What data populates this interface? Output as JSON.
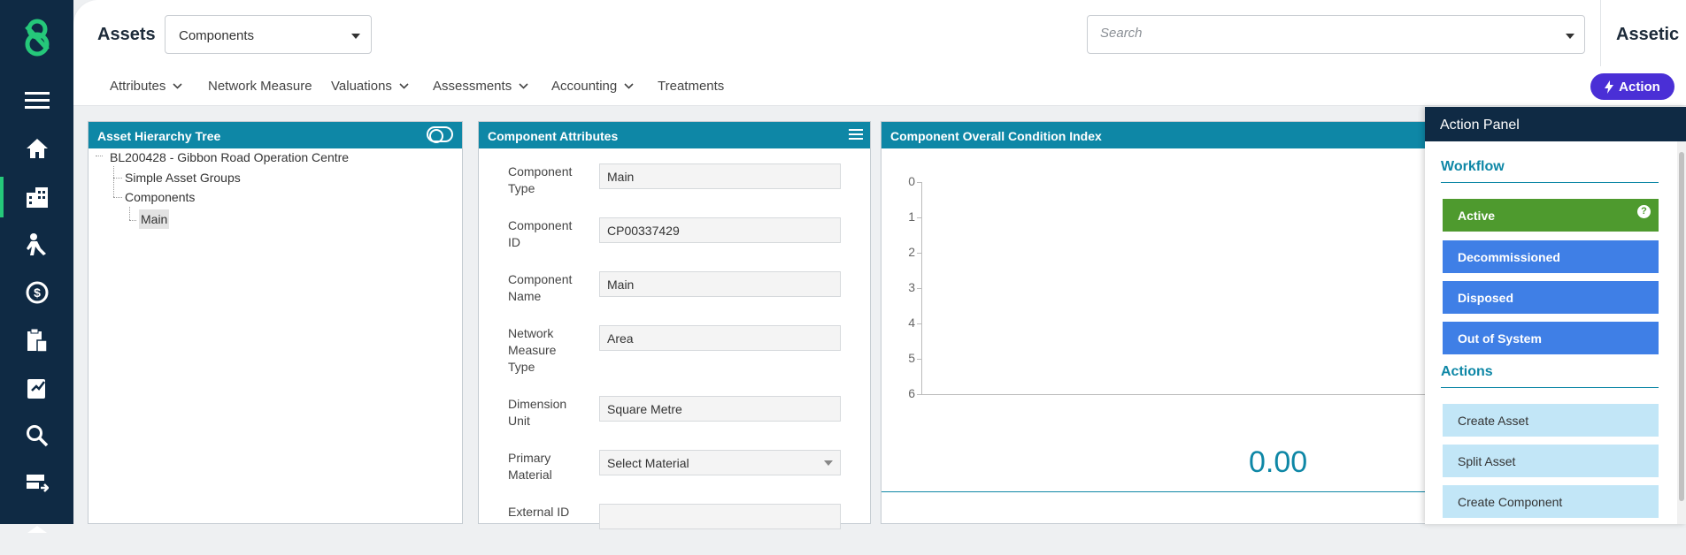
{
  "rail": {
    "icons": [
      "menu-icon",
      "home-icon",
      "buildings-icon",
      "worker-icon",
      "finance-icon",
      "clipboard-icon",
      "assessment-icon",
      "search-icon",
      "server-icon"
    ]
  },
  "header": {
    "title": "Assets",
    "module_select": "Components",
    "search_placeholder": "Search",
    "brand": "Assetic"
  },
  "subnav": {
    "items": [
      {
        "label": "Attributes",
        "dropdown": true
      },
      {
        "label": "Network Measure",
        "dropdown": false
      },
      {
        "label": "Valuations",
        "dropdown": true
      },
      {
        "label": "Assessments",
        "dropdown": true
      },
      {
        "label": "Accounting",
        "dropdown": true
      },
      {
        "label": "Treatments",
        "dropdown": false
      }
    ],
    "action_label": "Action"
  },
  "tree": {
    "title": "Asset Hierarchy Tree",
    "root": "BL200428 - Gibbon Road Operation Centre",
    "child1": "Simple Asset Groups",
    "child2": "Components",
    "leaf": "Main"
  },
  "attributes": {
    "title": "Component Attributes",
    "rows": [
      {
        "label": "Component Type",
        "value": "Main"
      },
      {
        "label": "Component ID",
        "value": "CP00337429"
      },
      {
        "label": "Component Name",
        "value": "Main"
      },
      {
        "label": "Network Measure Type",
        "value": "Area"
      },
      {
        "label": "Dimension Unit",
        "value": "Square Metre"
      },
      {
        "label": "Primary Material",
        "value": "Select Material"
      },
      {
        "label": "External ID",
        "value": ""
      }
    ]
  },
  "condition": {
    "title": "Component Overall Condition Index",
    "y_ticks": [
      "0",
      "1",
      "2",
      "3",
      "4",
      "5",
      "6"
    ],
    "value": "0.00"
  },
  "action_panel": {
    "title": "Action Panel",
    "workflow_label": "Workflow",
    "workflow": [
      {
        "label": "Active",
        "state": "active"
      },
      {
        "label": "Decommissioned",
        "state": "blue"
      },
      {
        "label": "Disposed",
        "state": "blue"
      },
      {
        "label": "Out of System",
        "state": "blue"
      }
    ],
    "actions_label": "Actions",
    "actions": [
      "Create Asset",
      "Split Asset",
      "Create Component"
    ],
    "help": "?"
  },
  "colors": {
    "rail": "#0f2a44",
    "accent_teal": "#0e87a6",
    "action_purple": "#4a2fd6",
    "active_green": "#4e9a2e",
    "workflow_blue": "#3f7fe6",
    "action_light": "#c2e6f7",
    "logo_green": "#25c87a"
  }
}
